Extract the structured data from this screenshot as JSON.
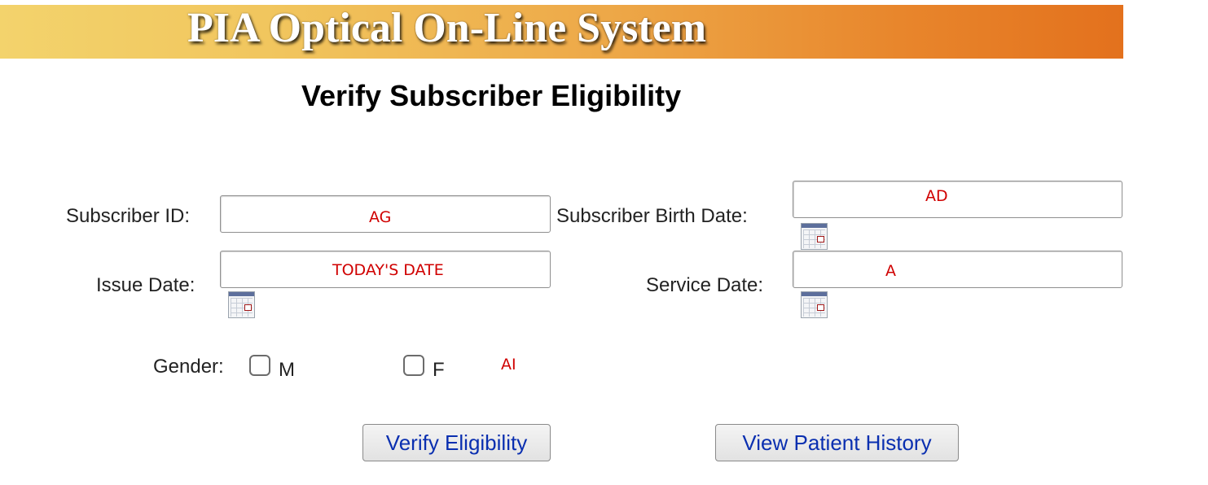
{
  "banner": {
    "title": "PIA Optical On-Line System"
  },
  "page": {
    "title": "Verify Subscriber Eligibility"
  },
  "form": {
    "subscriber_id_label": "Subscriber ID:",
    "subscriber_birth_date_label": "Subscriber Birth Date:",
    "issue_date_label": "Issue Date:",
    "service_date_label": "Service Date:",
    "gender_label": "Gender:",
    "gender_male_label": "M",
    "gender_female_label": "F",
    "subscriber_id_value": "",
    "subscriber_birth_date_value": "",
    "issue_date_value": "",
    "service_date_value": ""
  },
  "overlays": {
    "subscriber_id": "AG",
    "subscriber_birth_date": "AD",
    "issue_date": "TODAY'S DATE",
    "service_date": "A",
    "gender": "AI"
  },
  "buttons": {
    "verify_label": "Verify Eligibility",
    "history_label": "View Patient History"
  },
  "icons": {
    "calendar": "calendar-icon"
  },
  "colors": {
    "banner_start": "#f3d36c",
    "banner_end": "#e3711d",
    "annotation": "#d00000",
    "button_text": "#0a2fb0"
  }
}
